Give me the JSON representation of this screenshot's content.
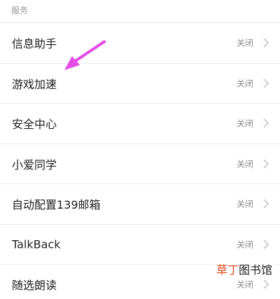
{
  "section": {
    "title": "服务"
  },
  "items": [
    {
      "label": "信息助手",
      "status": "关闭"
    },
    {
      "label": "游戏加速",
      "status": "关闭"
    },
    {
      "label": "安全中心",
      "status": "关闭"
    },
    {
      "label": "小爱同学",
      "status": "关闭"
    },
    {
      "label": "自动配置139邮箱",
      "status": "关闭"
    },
    {
      "label": "TalkBack",
      "status": "关闭"
    },
    {
      "label": "随选朗读",
      "status": "关闭"
    }
  ],
  "annotation": {
    "arrow_color": "#e34de6"
  },
  "watermark": {
    "part1": "草丁",
    "part2": "图书馆"
  },
  "colors": {
    "text": "#222222",
    "status": "#8a8a8a",
    "divider": "#ececec"
  }
}
